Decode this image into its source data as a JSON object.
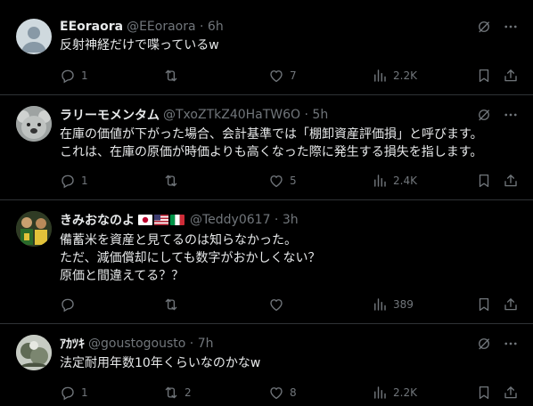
{
  "tweets": [
    {
      "name": "EEoraora",
      "meta": "@EEoraora · 6h",
      "lines": [
        "反射神経だけで喋っているw"
      ],
      "replies": "1",
      "reposts": "",
      "likes": "7",
      "views": "2.2K"
    },
    {
      "name": "ラリーモメンタム",
      "meta": "@TxoZTkZ40HaTW6O · 5h",
      "lines": [
        "在庫の価値が下がった場合、会計基準では「棚卸資産評価損」と呼びます。",
        "これは、在庫の原価が時価よりも高くなった際に発生する損失を指します。"
      ],
      "replies": "1",
      "reposts": "",
      "likes": "5",
      "views": "2.4K"
    },
    {
      "name": "きみおなのよ",
      "meta": "@Teddy0617 · 3h",
      "lines": [
        "備蓄米を資産と見てるのは知らなかった。",
        "ただ、減価償却にしても数字がおかしくない？",
        "原価と間違えてる？？"
      ],
      "replies": "",
      "reposts": "",
      "likes": "",
      "views": "389"
    },
    {
      "name": "ｱｶﾂｷ",
      "meta": "@goustogousto · 7h",
      "lines": [
        "法定耐用年数10年くらいなのかなw"
      ],
      "replies": "1",
      "reposts": "2",
      "likes": "8",
      "views": "2.2K"
    }
  ],
  "icons": [
    "grok-icon",
    "more-icon",
    "reply-icon",
    "repost-icon",
    "like-icon",
    "views-icon",
    "bookmark-icon",
    "share-icon"
  ],
  "colors": {
    "background": "#000000",
    "text": "#e7e9ea",
    "secondary": "#71767b",
    "divider": "#2f3336"
  }
}
